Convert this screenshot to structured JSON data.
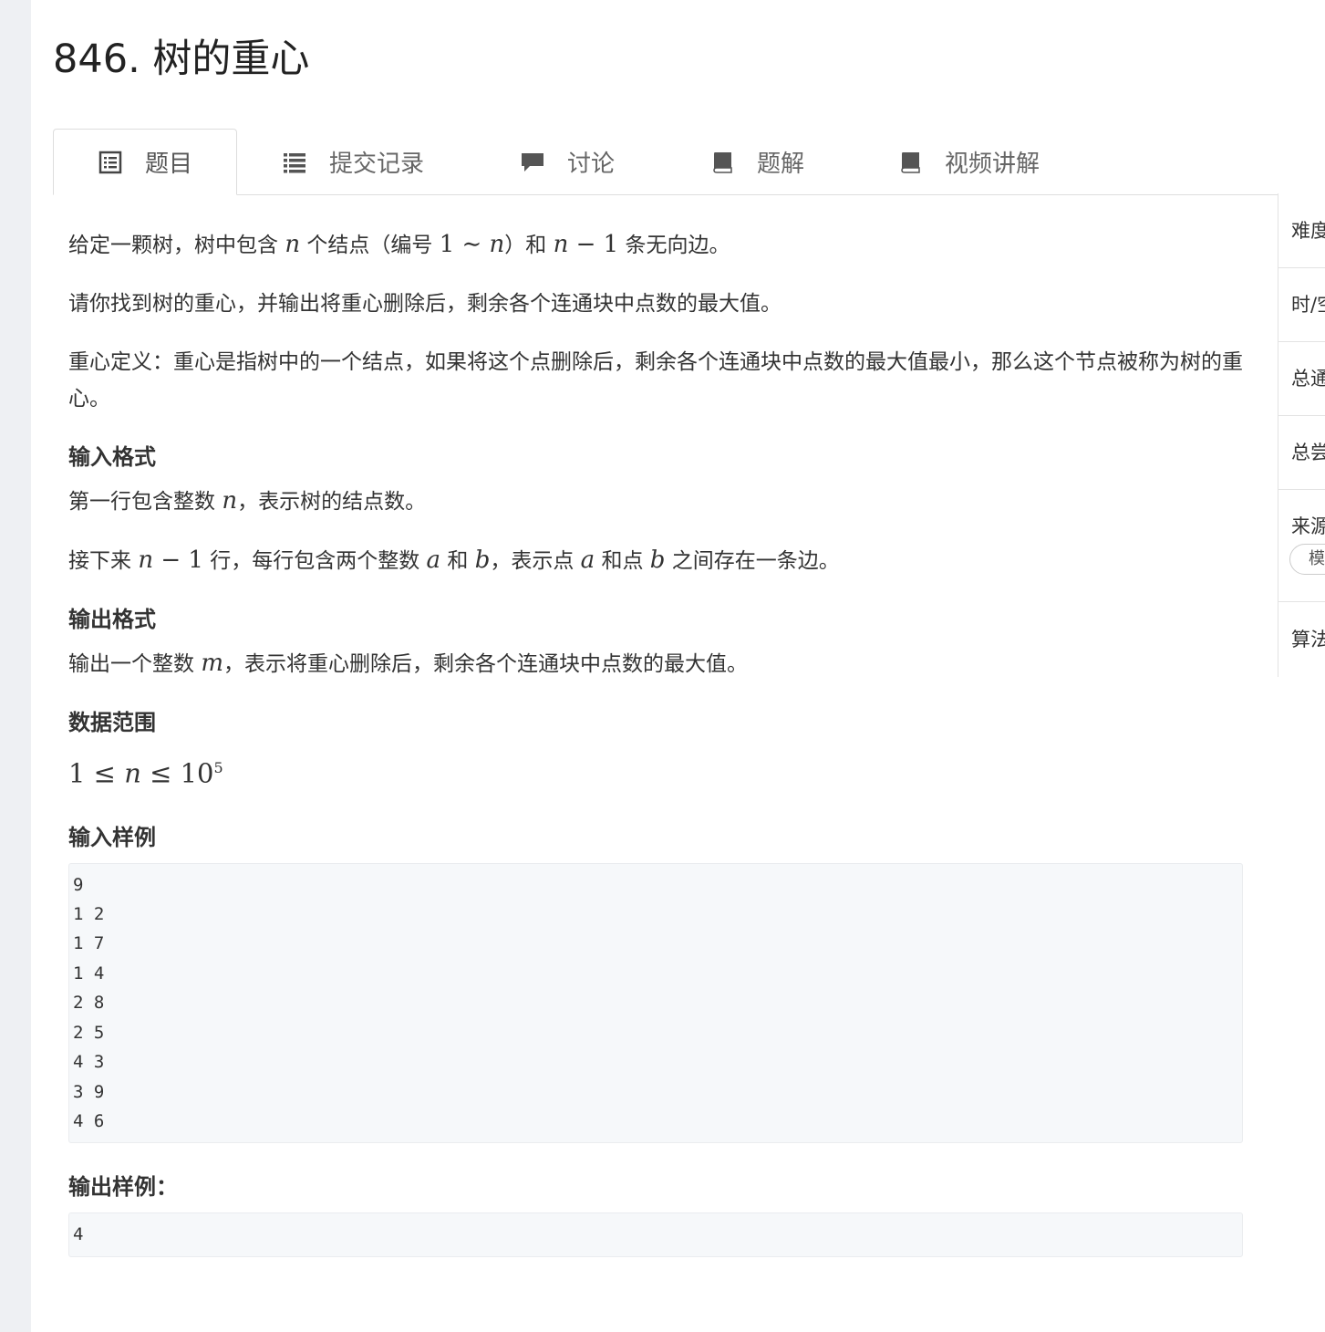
{
  "problem": {
    "title": "846. 树的重心"
  },
  "tabs": [
    {
      "label": "题目",
      "icon": "list-alt-icon"
    },
    {
      "label": "提交记录",
      "icon": "list-icon"
    },
    {
      "label": "讨论",
      "icon": "comment-icon"
    },
    {
      "label": "题解",
      "icon": "book-icon"
    },
    {
      "label": "视频讲解",
      "icon": "book-icon"
    }
  ],
  "statement": {
    "p1": [
      "给定一颗树，树中包含 ",
      "n",
      " 个结点（编号 ",
      "1 ∼ ",
      "n",
      "）和 ",
      "n",
      " − 1",
      " 条无向边。"
    ],
    "p2": "请你找到树的重心，并输出将重心删除后，剩余各个连通块中点数的最大值。",
    "p3": "重心定义：重心是指树中的一个结点，如果将这个点删除后，剩余各个连通块中点数的最大值最小，那么这个节点被称为树的重心。",
    "input_heading": "输入格式",
    "input_p1": [
      "第一行包含整数 ",
      "n",
      "，表示树的结点数。"
    ],
    "input_p2": [
      "接下来 ",
      "n",
      " − 1",
      " 行，每行包含两个整数 ",
      "a",
      " 和 ",
      "b",
      "，表示点 ",
      "a",
      " 和点 ",
      "b",
      " 之间存在一条边。"
    ],
    "output_heading": "输出格式",
    "output_p": [
      "输出一个整数 ",
      "m",
      "，表示将重心删除后，剩余各个连通块中点数的最大值。"
    ],
    "range_heading": "数据范围",
    "range": {
      "left": "1 ≤ ",
      "var": "n",
      "mid": " ≤ 10",
      "exp": "5"
    },
    "sample_input_heading": "输入样例",
    "sample_input": "9\n1 2\n1 7\n1 4\n2 8\n2 5\n4 3\n3 9\n4 6",
    "sample_output_heading": "输出样例：",
    "sample_output": "4"
  },
  "sidebar": {
    "rows": [
      "难度",
      "时/空",
      "总通",
      "总尝",
      "来源",
      "算法"
    ],
    "tag": "模"
  },
  "colors": {
    "page_bg": "#eef0f3",
    "code_bg": "#f6f8fa",
    "border": "#dddddd"
  }
}
